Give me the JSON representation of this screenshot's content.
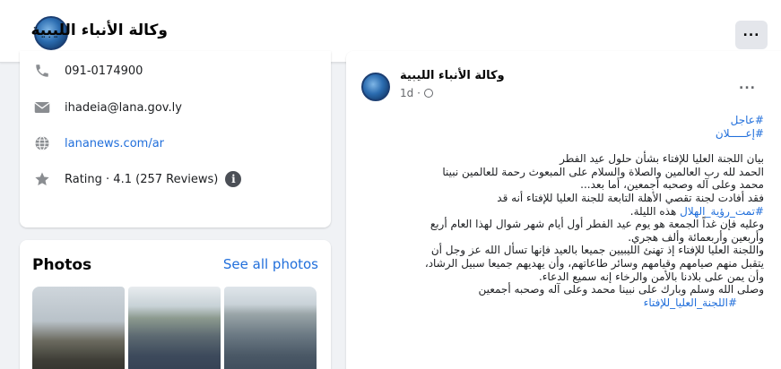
{
  "page": {
    "name": "وكالة الأنباء الليبية",
    "more_label": "..."
  },
  "intro": {
    "phone": "091-0174900",
    "email": "ihadeia@lana.gov.ly",
    "website": "lananews.com/ar",
    "rating": "Rating · 4.1 (257 Reviews)",
    "rating_info_glyph": "i"
  },
  "photos": {
    "title": "Photos",
    "see_all": "See all photos"
  },
  "post": {
    "author": "وكالة الأنباء الليبية",
    "time": "1d ·",
    "more_label": "...",
    "hashtags": [
      "#عاجل",
      "#إعـــــلان"
    ],
    "lines": [
      "بيان اللجنة العليا للإفتاء بشأن حلول عيد الفطر",
      "الحمد لله رب العالمين والصلاة والسلام على المبعوث رحمة للعالمين نبينا",
      "محمد وعلى آله وصحبه أجمعين، أما بعد...",
      "فقد أفادت لجنة تقصي الأهلة التابعة للجنة العليا للإفتاء أنه قد"
    ],
    "hilal_tag": "#تمت_رؤية_الهلال",
    "hilal_rest": " هذه الليلة.",
    "lines2": [
      "وعليه فإن غداً الجمعة هو يوم عيد الفطر أول أيام شهر شوال لهذا العام أربع",
      "وأربعين وأربعمائة وألف هجري.",
      "واللجنة العليا للإفتاء إذ تهنئ الليبيين جميعا بالعيد فإنها تسأل الله عز وجل أن",
      "يتقبل منهم صيامهم وقيامهم وسائر طاعاتهم، وأن يهديهم جميعا سبيل الرشاد،",
      "وأن يمن على بلادنا بالأمن والرخاء  إنه سميع الدعاء.",
      "وصلى الله وسلم وبارك على نبينا محمد وعلى آله وصحبه أجمعين"
    ],
    "footer_tag": "#اللجنة_العليا_للإفتاء"
  },
  "icons": {
    "phone": "phone-icon",
    "email": "envelope-icon",
    "website": "globe-icon",
    "rating": "star-icon",
    "info": "info-icon",
    "privacy": "globe-icon"
  },
  "colors": {
    "link": "#216fdb",
    "background": "#f0f2f5",
    "card": "#ffffff"
  }
}
